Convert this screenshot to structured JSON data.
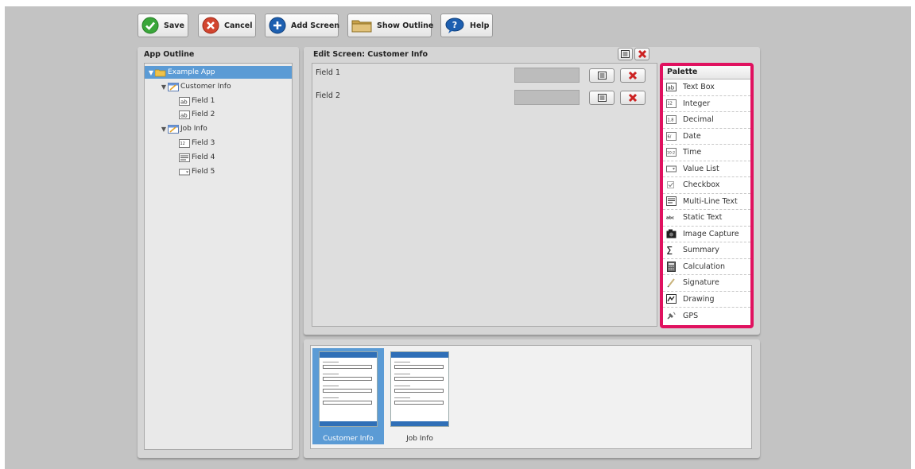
{
  "toolbar": {
    "save": "Save",
    "cancel": "Cancel",
    "add_screen": "Add Screen",
    "show_outline": "Show Outline",
    "help": "Help"
  },
  "outline": {
    "title": "App Outline",
    "items": [
      {
        "label": "Example App",
        "level": 0,
        "icon": "folder-icon",
        "expanded": true,
        "selected": true
      },
      {
        "label": "Customer Info",
        "level": 1,
        "icon": "screen-icon",
        "expanded": true,
        "selected": false
      },
      {
        "label": "Field 1",
        "level": 2,
        "icon": "textbox-icon",
        "selected": false
      },
      {
        "label": "Field 2",
        "level": 2,
        "icon": "textbox-icon",
        "selected": false
      },
      {
        "label": "Job Info",
        "level": 1,
        "icon": "screen-icon",
        "expanded": true,
        "selected": false
      },
      {
        "label": "Field 3",
        "level": 2,
        "icon": "integer-icon",
        "selected": false
      },
      {
        "label": "Field 4",
        "level": 2,
        "icon": "multiline-icon",
        "selected": false
      },
      {
        "label": "Field 5",
        "level": 2,
        "icon": "valuelist-icon",
        "selected": false
      }
    ]
  },
  "editor": {
    "title": "Edit Screen: Customer Info",
    "fields": [
      {
        "label": "Field 1"
      },
      {
        "label": "Field 2"
      }
    ]
  },
  "palette": {
    "title": "Palette",
    "items": [
      {
        "label": "Text Box",
        "icon": "textbox-icon"
      },
      {
        "label": "Integer",
        "icon": "integer-icon"
      },
      {
        "label": "Decimal",
        "icon": "decimal-icon"
      },
      {
        "label": "Date",
        "icon": "date-icon"
      },
      {
        "label": "Time",
        "icon": "time-icon"
      },
      {
        "label": "Value List",
        "icon": "valuelist-icon"
      },
      {
        "label": "Checkbox",
        "icon": "checkbox-icon"
      },
      {
        "label": "Multi-Line Text",
        "icon": "multiline-icon"
      },
      {
        "label": "Static Text",
        "icon": "static-text-icon"
      },
      {
        "label": "Image Capture",
        "icon": "camera-icon"
      },
      {
        "label": "Summary",
        "icon": "sigma-icon"
      },
      {
        "label": "Calculation",
        "icon": "calculator-icon"
      },
      {
        "label": "Signature",
        "icon": "pen-icon"
      },
      {
        "label": "Drawing",
        "icon": "drawing-icon"
      },
      {
        "label": "GPS",
        "icon": "satellite-icon"
      }
    ]
  },
  "screens": [
    {
      "label": "Customer Info",
      "selected": true
    },
    {
      "label": "Job Info",
      "selected": false
    }
  ],
  "colors": {
    "highlight_border": "#e0115f",
    "selection": "#5b9bd5",
    "thumb_selected": "#5b9bd5"
  }
}
